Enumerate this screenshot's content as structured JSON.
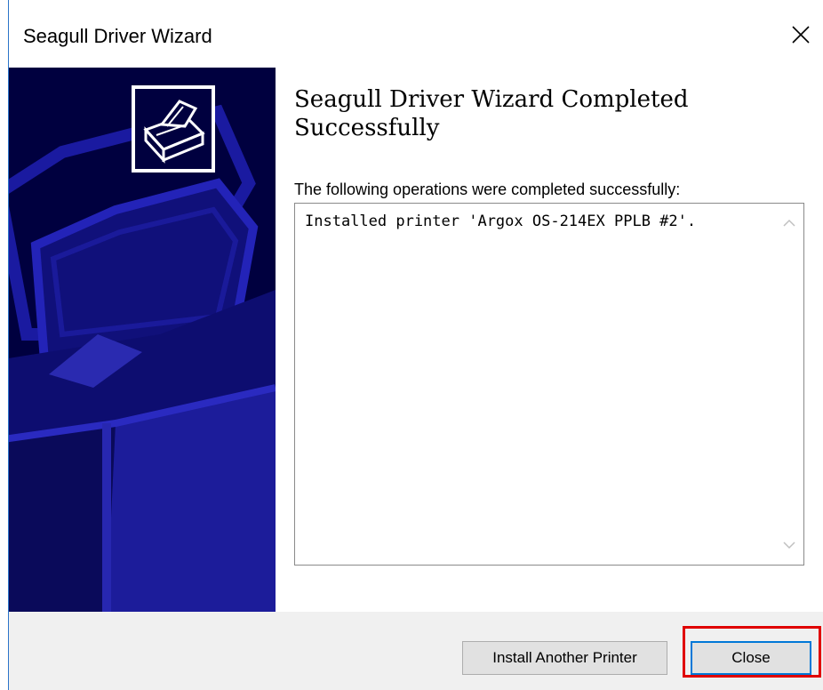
{
  "window": {
    "title": "Seagull Driver Wizard",
    "close_icon": "close-icon"
  },
  "main": {
    "heading": "Seagull Driver Wizard Completed Successfully",
    "subheading": "The following operations were completed successfully:",
    "results": [
      "Installed printer 'Argox OS-214EX PPLB #2'."
    ]
  },
  "side_panel": {
    "background_color": "#00003f",
    "logo_icon": "printer-logo-icon"
  },
  "footer": {
    "install_another_label": "Install Another Printer",
    "close_label": "Close"
  },
  "colors": {
    "accent_focus": "#0078d7",
    "highlight": "#e00000"
  }
}
